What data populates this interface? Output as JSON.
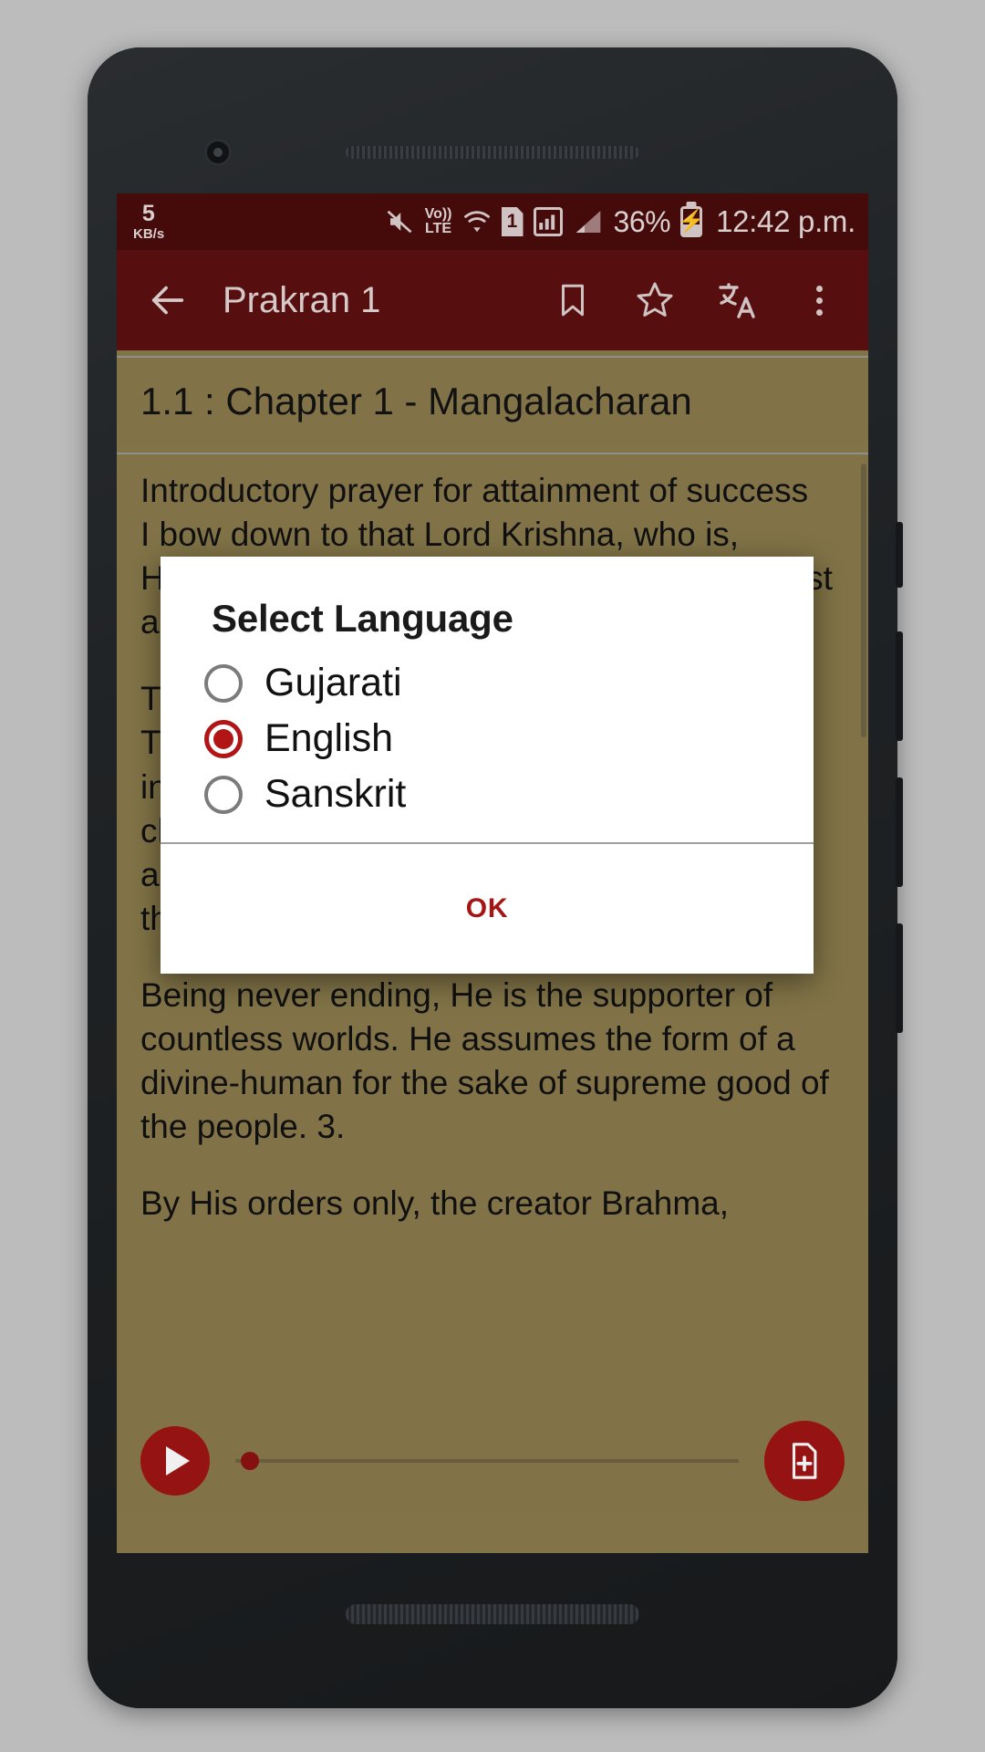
{
  "status_bar": {
    "net_speed_value": "5",
    "net_speed_unit": "KB/s",
    "mute_icon": "mute-icon",
    "volte_top": "Vo))",
    "volte_bottom": "LTE",
    "wifi_icon": "wifi-icon",
    "sim_label": "1",
    "signal_icon_1": "signal-boxed-icon",
    "signal_icon_2": "signal-bars-icon",
    "battery_percent": "36%",
    "battery_icon": "battery-charging-icon",
    "time": "12:42 p.m."
  },
  "app_bar": {
    "back_icon": "back-arrow-icon",
    "title": "Prakran 1",
    "bookmark_icon": "bookmark-icon",
    "favorite_icon": "star-outline-icon",
    "translate_icon": "translate-icon",
    "overflow_icon": "more-vert-icon"
  },
  "chapter": {
    "heading": "1.1 : Chapter 1 - Mangalacharan"
  },
  "content": {
    "paragraphs": [
      "Introductory prayer for attainment of success\nI bow down to that Lord Krishna, who is, Himself the son of Dharma, who being m                                     da                                              st as",
      "Th\nTh\nina\nch\nan\nth",
      "Being never ending, He is the supporter of countless worlds. He assumes the form of a divine-human for the sake of supreme good of the people. 3.",
      "By His orders only, the creator Brahma,"
    ]
  },
  "dialog": {
    "title": "Select Language",
    "options": [
      {
        "label": "Gujarati",
        "selected": false
      },
      {
        "label": "English",
        "selected": true
      },
      {
        "label": "Sanskrit",
        "selected": false
      }
    ],
    "ok_label": "OK"
  },
  "player": {
    "play_icon": "play-icon",
    "seek_position_percent": 1,
    "add_note_icon": "add-file-icon"
  },
  "colors": {
    "status_bar": "#4a0b0b",
    "app_bar": "#5c0f0f",
    "page_background": "#8a7b4c",
    "accent": "#b11515",
    "dialog_background": "#ffffff"
  }
}
